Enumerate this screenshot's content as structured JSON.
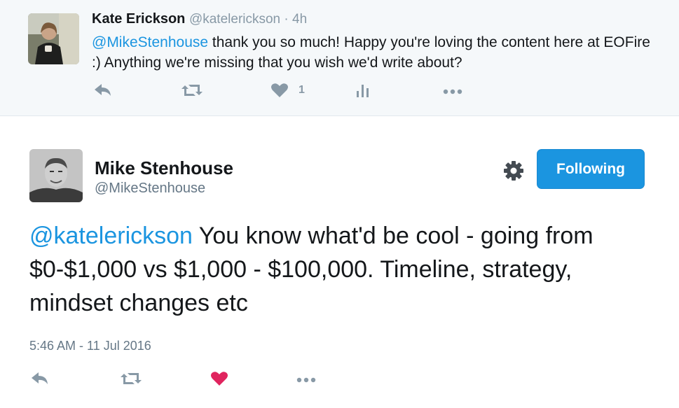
{
  "reply": {
    "author_name": "Kate Erickson",
    "author_handle": "@katelerickson",
    "separator": " · ",
    "time": "4h",
    "mention": "@MikeStenhouse",
    "text": " thank you so much! Happy you're loving the content here at EOFire :) Anything we're missing that you wish we'd write about?",
    "like_count": "1",
    "actions": [
      "reply-icon",
      "retweet-icon",
      "like-icon",
      "analytics-icon",
      "more-icon"
    ]
  },
  "tweet": {
    "author_name": "Mike Stenhouse",
    "author_handle": "@MikeStenhouse",
    "follow_label": "Following",
    "mention": "@katelerickson",
    "text": " You know what'd be cool - going from $0-$1,000 vs $1,000 - $100,000. Timeline, strategy, mindset changes etc",
    "timestamp": "5:46 AM - 11 Jul 2016",
    "actions": [
      "reply-icon",
      "retweet-icon",
      "like-icon-filled",
      "more-icon"
    ]
  },
  "colors": {
    "link": "#1b95e0",
    "icon": "#8899a6",
    "like_active": "#e0245e",
    "reply_background": "#f5f8fa",
    "follow_button": "#1b95e0"
  }
}
